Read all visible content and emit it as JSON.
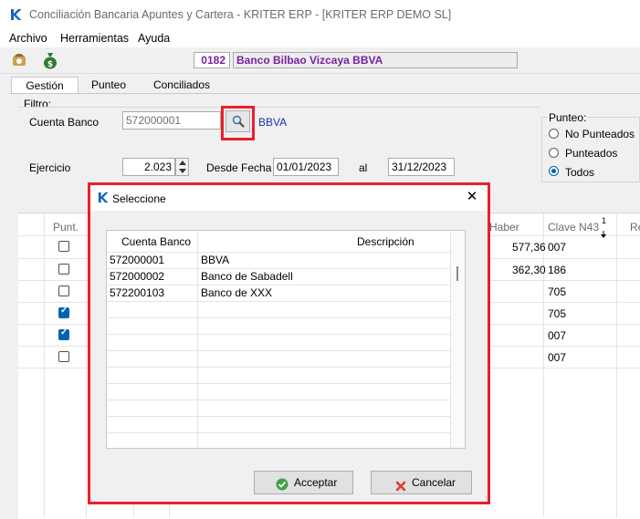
{
  "window": {
    "title": "Conciliación Bancaria Apuntes y Cartera - KRITER ERP - [KRITER ERP DEMO SL]",
    "logo_letter": "K"
  },
  "menu": [
    "Archivo",
    "Herramientas",
    "Ayuda"
  ],
  "toolbar": {
    "bank_code": "0182",
    "bank_name": "Banco Bilbao Vizcaya BBVA"
  },
  "tabs": [
    "Gestión",
    "Punteo",
    "Conciliados"
  ],
  "filter": {
    "group_label": "Filtro:",
    "cuenta_label": "Cuenta Banco",
    "cuenta_value": "572000001",
    "cuenta_desc": "BBVA",
    "ejercicio_label": "Ejercicio",
    "ejercicio_value": "2.023",
    "desde_label": "Desde Fecha",
    "desde_value": "01/01/2023",
    "al_label": "al",
    "hasta_value": "31/12/2023"
  },
  "punteo": {
    "label": "Punteo:",
    "options": [
      {
        "label": "No Punteados",
        "selected": false
      },
      {
        "label": "Punteados",
        "selected": false
      },
      {
        "label": "Todos",
        "selected": true
      }
    ]
  },
  "grid": {
    "headers": {
      "punt": "Punt.",
      "haber": "Haber",
      "clave": "Clave N43",
      "re": "Re"
    },
    "sort_indicator": "1",
    "rows": [
      {
        "checked": false,
        "haber": "577,36",
        "clave": "007"
      },
      {
        "checked": false,
        "haber": "362,30",
        "clave": "186"
      },
      {
        "checked": false,
        "haber": "",
        "clave": "705"
      },
      {
        "checked": true,
        "haber": "",
        "clave": "705"
      },
      {
        "checked": true,
        "haber": "",
        "clave": "007"
      },
      {
        "checked": false,
        "haber": "",
        "clave": "007"
      }
    ]
  },
  "dialog": {
    "title": "Seleccione",
    "close": "✕",
    "headers": {
      "cuenta": "Cuenta Banco",
      "descripcion": "Descripción"
    },
    "rows": [
      {
        "cuenta": "572000001",
        "descripcion": "BBVA"
      },
      {
        "cuenta": "572000002",
        "descripcion": "Banco de Sabadell"
      },
      {
        "cuenta": "572200103",
        "descripcion": "Banco de XXX"
      }
    ],
    "accept_label": "Acceptar",
    "cancel_label": "Cancelar"
  },
  "colors": {
    "highlight": "#e8202c",
    "bank_text": "#7a1fa2",
    "accent": "#0063b1"
  }
}
